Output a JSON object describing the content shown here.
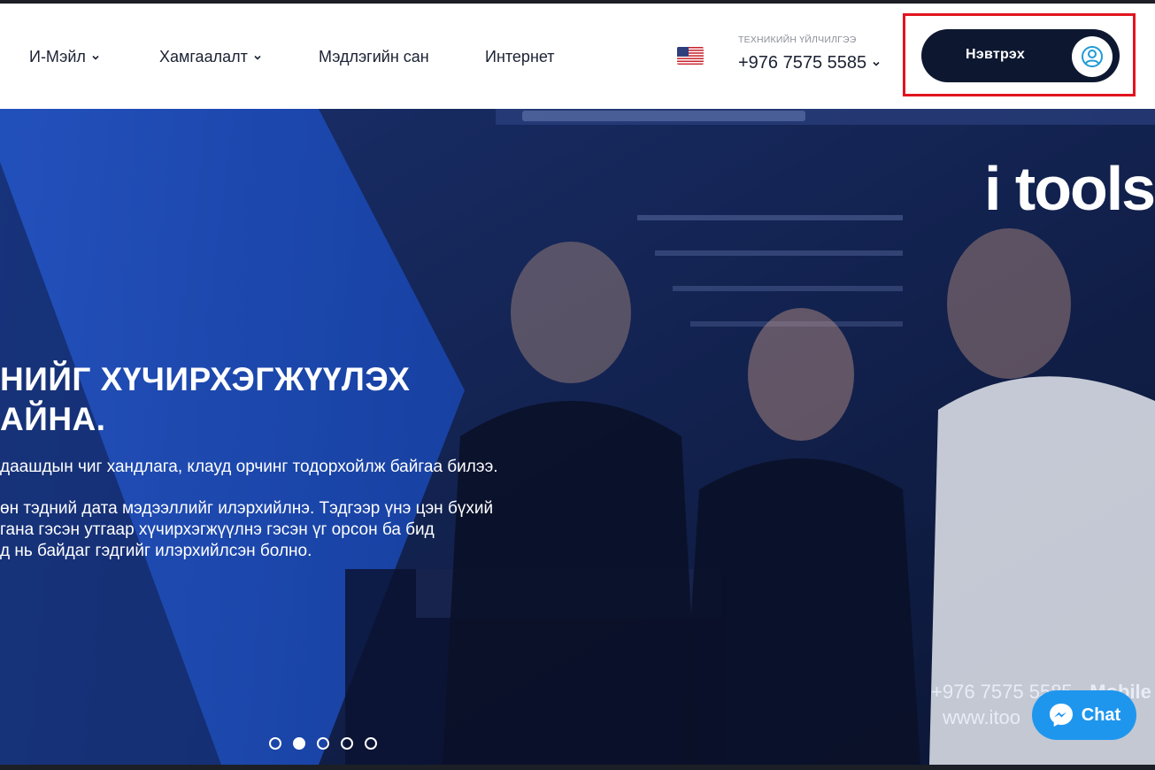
{
  "nav": {
    "items": [
      {
        "label": "И-Мэйл",
        "has_dropdown": true
      },
      {
        "label": "Хамгаалалт",
        "has_dropdown": true
      },
      {
        "label": "Мэдлэгийн сан",
        "has_dropdown": false
      },
      {
        "label": "Интернет",
        "has_dropdown": false
      }
    ],
    "language_icon": "us-flag-icon"
  },
  "support": {
    "label": "ТЕХНИКИЙН ҮЙЛЧИЛГЭЭ",
    "phone": "+976 7575 5585"
  },
  "login": {
    "label": "Нэвтрэх",
    "icon": "user-circle-icon",
    "highlight_color": "#e0141e"
  },
  "hero": {
    "title_line1": "НИЙГ ХҮЧИРХЭГЖҮҮЛЭХ",
    "title_line2": "АЙНА.",
    "paragraph1": "даашдын чиг хандлага, клауд орчинг тодорхойлж байгаа билээ.",
    "paragraph2_line1": "өн тэдний дата мэдээллийг илэрхийлнэ. Тэдгээр үнэ цэн бүхий",
    "paragraph2_line2": "гана гэсэн утгаар хүчирхэгжүүлнэ гэсэн үг орсон ба бид",
    "paragraph2_line3": "д нь байдаг гэдгийг илэрхийлсэн болно.",
    "brand": "i tools",
    "bottom_phone": "+976 7575 5585",
    "bottom_phone_suffix": "- Mobile",
    "bottom_web": "www.itoo",
    "slides_total": 5,
    "slide_active": 2
  },
  "chat": {
    "label": "Chat",
    "icon": "messenger-icon",
    "color": "#1f96ee"
  },
  "colors": {
    "primary_dark": "#0d1830",
    "hero_overlay": "#0f1c45",
    "accent_blue": "#1f6fe0"
  }
}
